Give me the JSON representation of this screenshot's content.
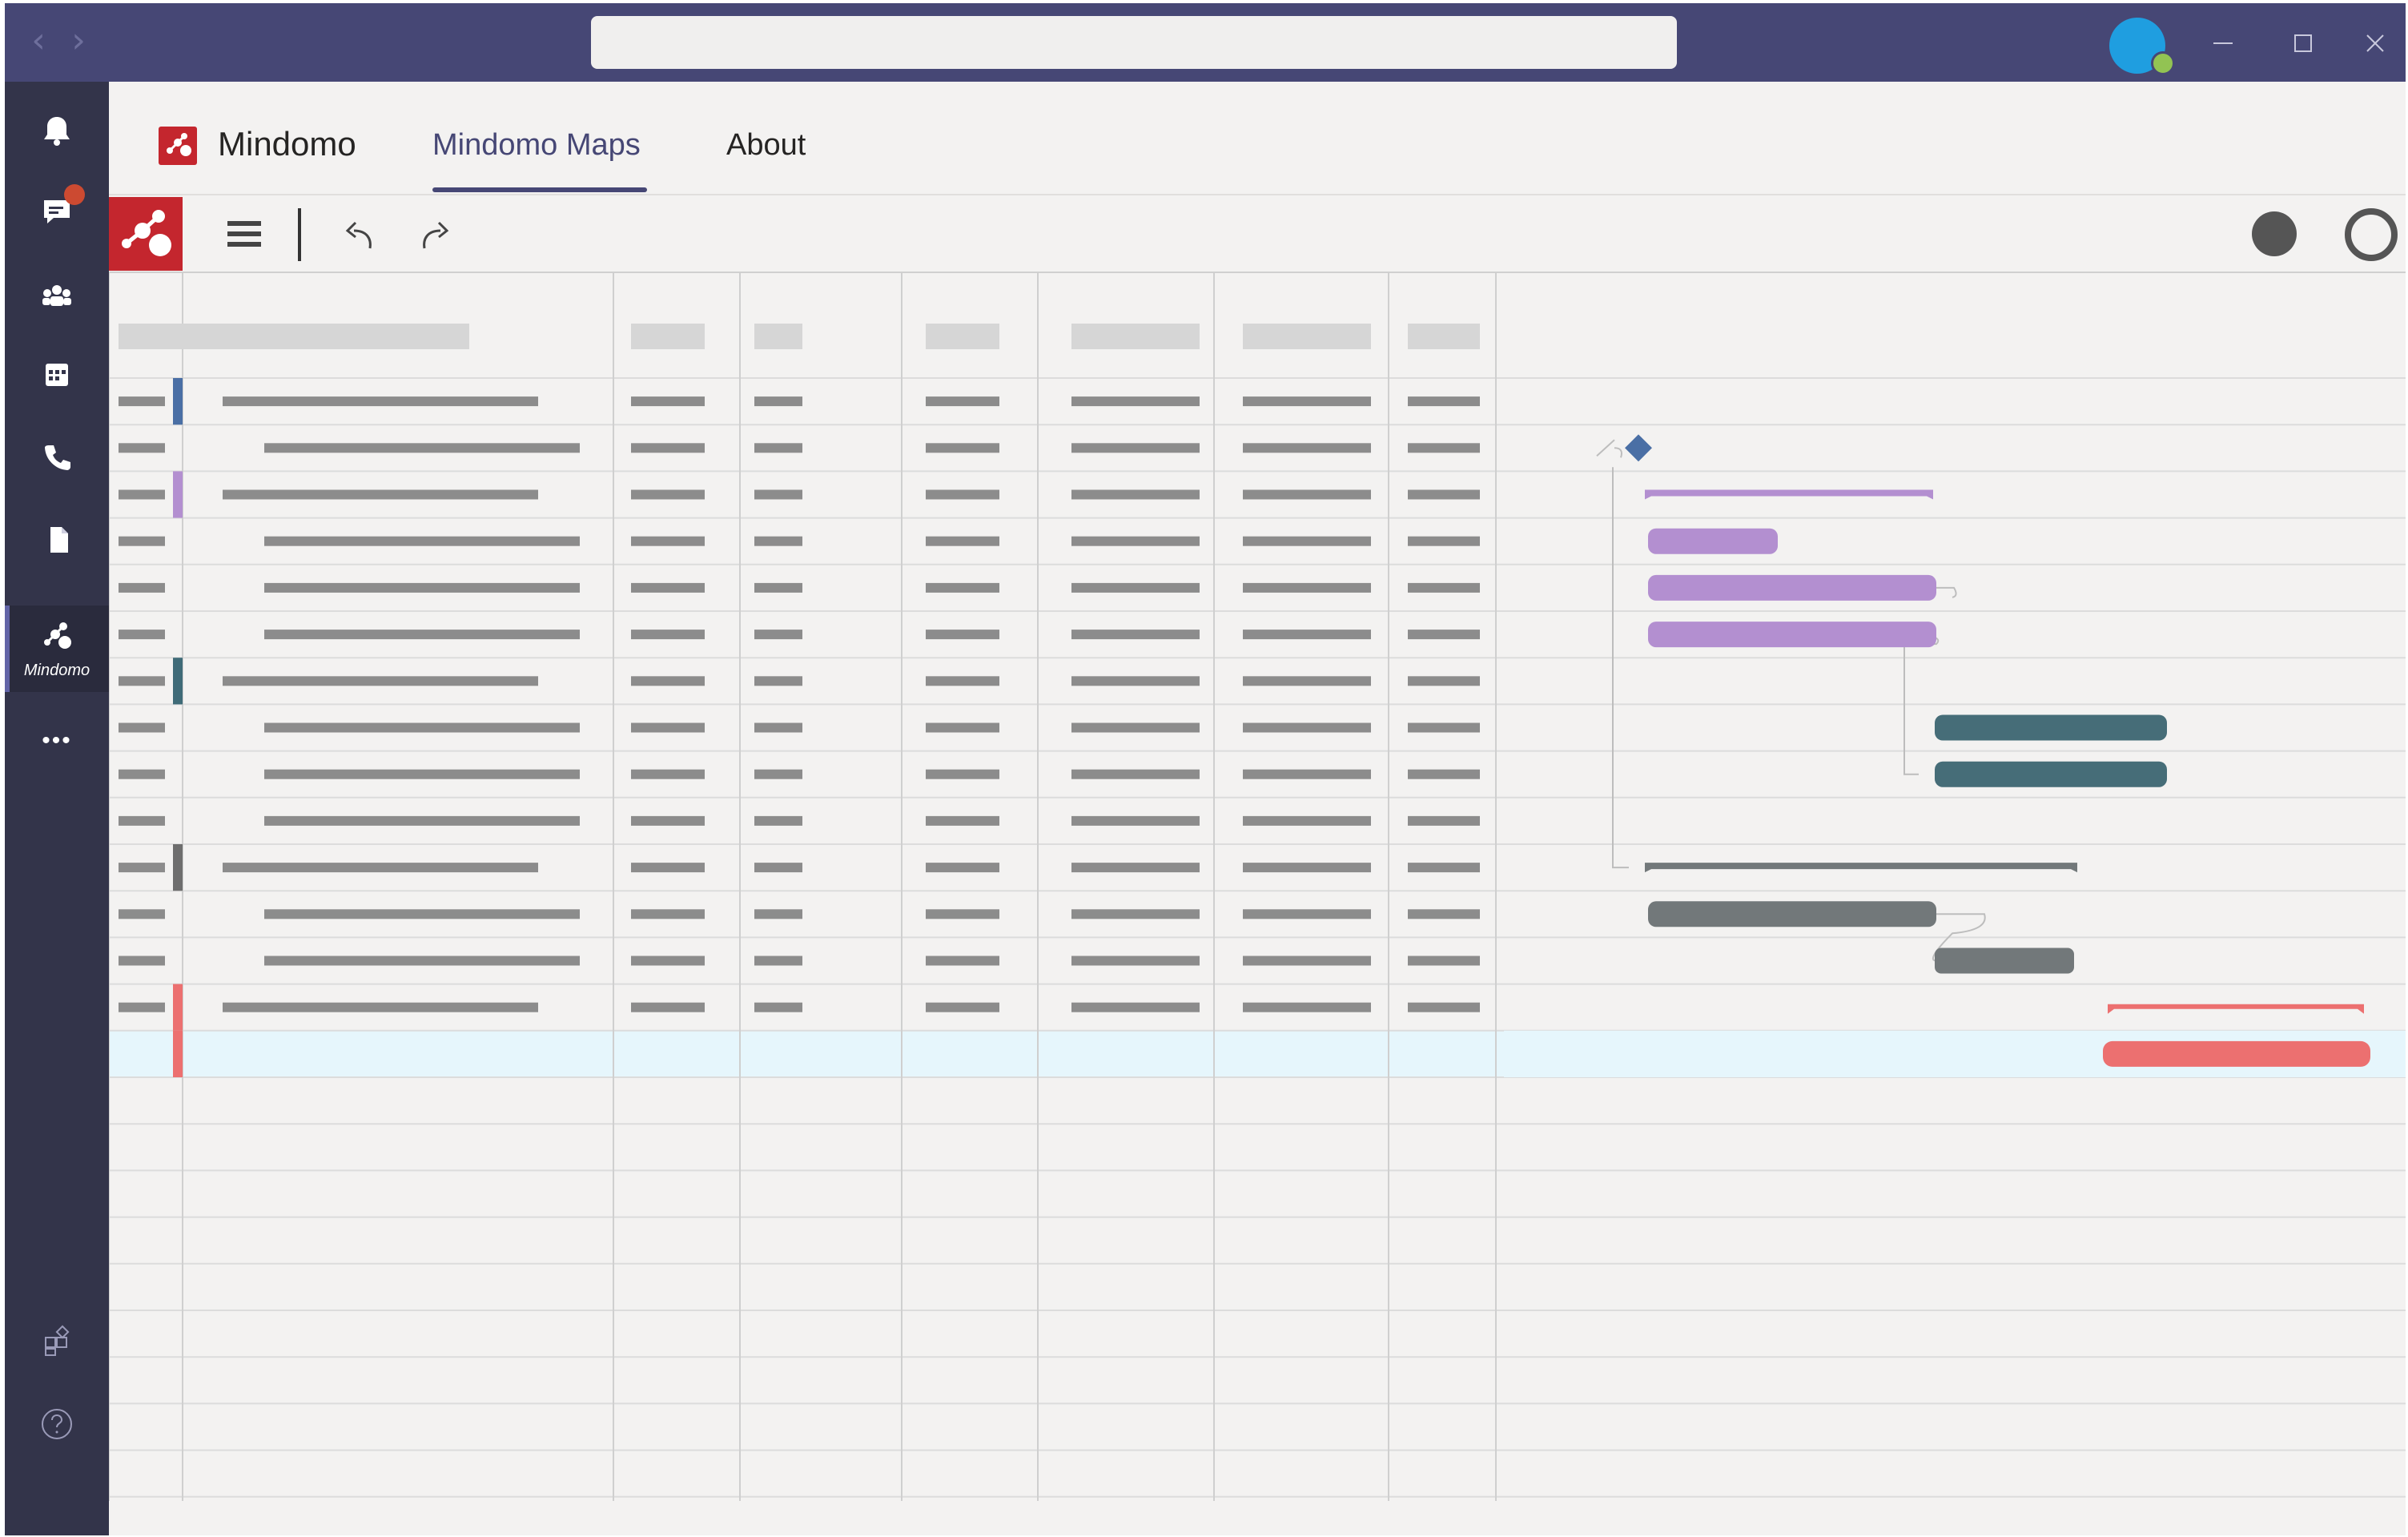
{
  "titlebar": {
    "back_label": "‹",
    "forward_label": "›",
    "search_placeholder": "",
    "window_controls": [
      "minimize",
      "maximize",
      "close"
    ]
  },
  "rail": {
    "items": [
      {
        "name": "activity",
        "icon": "bell-icon"
      },
      {
        "name": "chat",
        "icon": "chat-icon",
        "badge": true
      },
      {
        "name": "teams",
        "icon": "teams-icon"
      },
      {
        "name": "calendar",
        "icon": "calendar-icon"
      },
      {
        "name": "calls",
        "icon": "phone-icon"
      },
      {
        "name": "files",
        "icon": "file-icon"
      }
    ],
    "active_app_label": "Mindomo",
    "more_label": "•••"
  },
  "app": {
    "name": "Mindomo",
    "tabs": [
      {
        "label": "Mindomo Maps",
        "active": true
      },
      {
        "label": "About",
        "active": false
      }
    ]
  },
  "toolbar": {
    "actions": [
      "menu",
      "undo",
      "redo"
    ]
  },
  "gantt": {
    "row_colors": [
      "#4a6fa5",
      null,
      "#b38fd0",
      null,
      null,
      null,
      "#3f6b78",
      null,
      null,
      null,
      "#6e6e6e",
      null,
      null,
      "#ec7070",
      "#ec7070"
    ],
    "selected_row_index": 14,
    "colors": {
      "milestone": "#4a6fa5",
      "purple": "#b38fd0",
      "teal": "#466d78",
      "gray": "#72787a",
      "red": "#ec7070",
      "selection": "#e6f6fc"
    }
  }
}
